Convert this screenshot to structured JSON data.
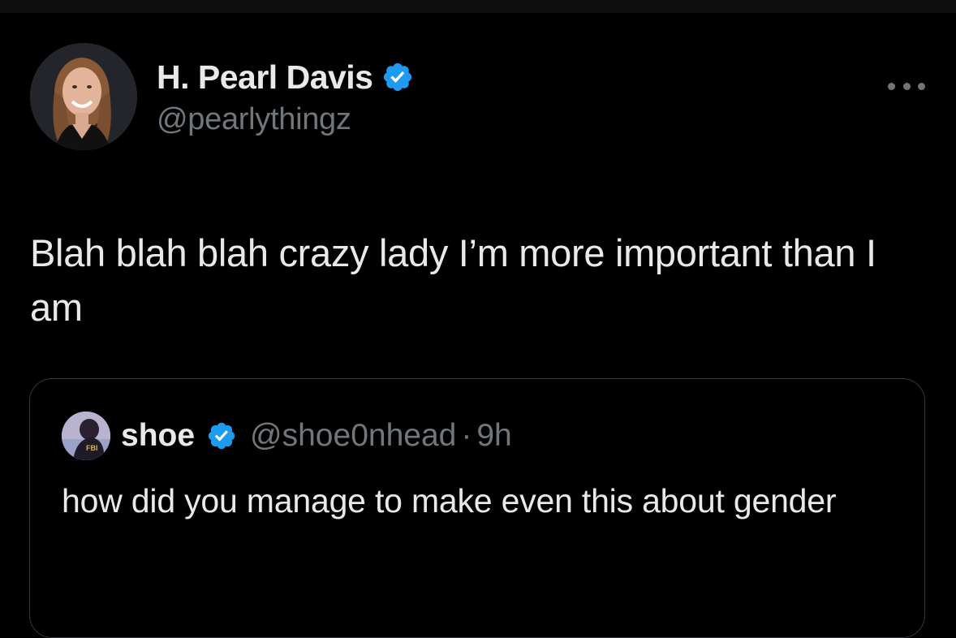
{
  "tweet": {
    "author": {
      "display_name": "H. Pearl Davis",
      "handle": "@pearlythingz",
      "verified": true,
      "avatar_icon": "profile-photo"
    },
    "more_icon": "more-options-icon",
    "text": "Blah blah blah crazy lady I’m more important than I am"
  },
  "quoted_tweet": {
    "author": {
      "display_name": "shoe",
      "handle": "@shoe0nhead",
      "verified": true,
      "avatar_icon": "profile-photo"
    },
    "separator": "·",
    "time": "9h",
    "text": "how did you manage to make even this about gender"
  },
  "colors": {
    "background": "#000000",
    "text_primary": "#e7e9ea",
    "text_secondary": "#71767b",
    "verified_blue": "#1d9bf0",
    "border": "#333639"
  }
}
